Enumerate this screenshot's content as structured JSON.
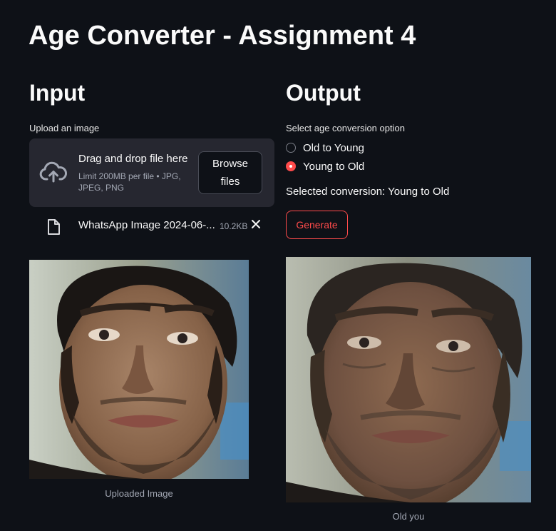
{
  "app": {
    "title": "Age Converter - Assignment 4"
  },
  "input": {
    "heading": "Input",
    "uploader_label": "Upload an image",
    "dropzone": {
      "title": "Drag and drop file here",
      "limit_text": "Limit 200MB per file • JPG, JPEG, PNG",
      "browse_label": "Browse files"
    },
    "file": {
      "name": "WhatsApp Image 2024-06-...",
      "size": "10.2KB"
    },
    "image_caption": "Uploaded Image"
  },
  "output": {
    "heading": "Output",
    "radio_label": "Select age conversion option",
    "options": [
      "Old to Young",
      "Young to Old"
    ],
    "selected_index": 1,
    "selected_text": "Selected conversion: Young to Old",
    "generate_label": "Generate",
    "image_caption": "Old you"
  },
  "colors": {
    "background": "#0e1117",
    "accent": "#ff4b4b",
    "dropzone": "#262730"
  },
  "icons": {
    "upload": "cloud-upload-icon",
    "file": "file-icon",
    "close": "close-icon"
  }
}
